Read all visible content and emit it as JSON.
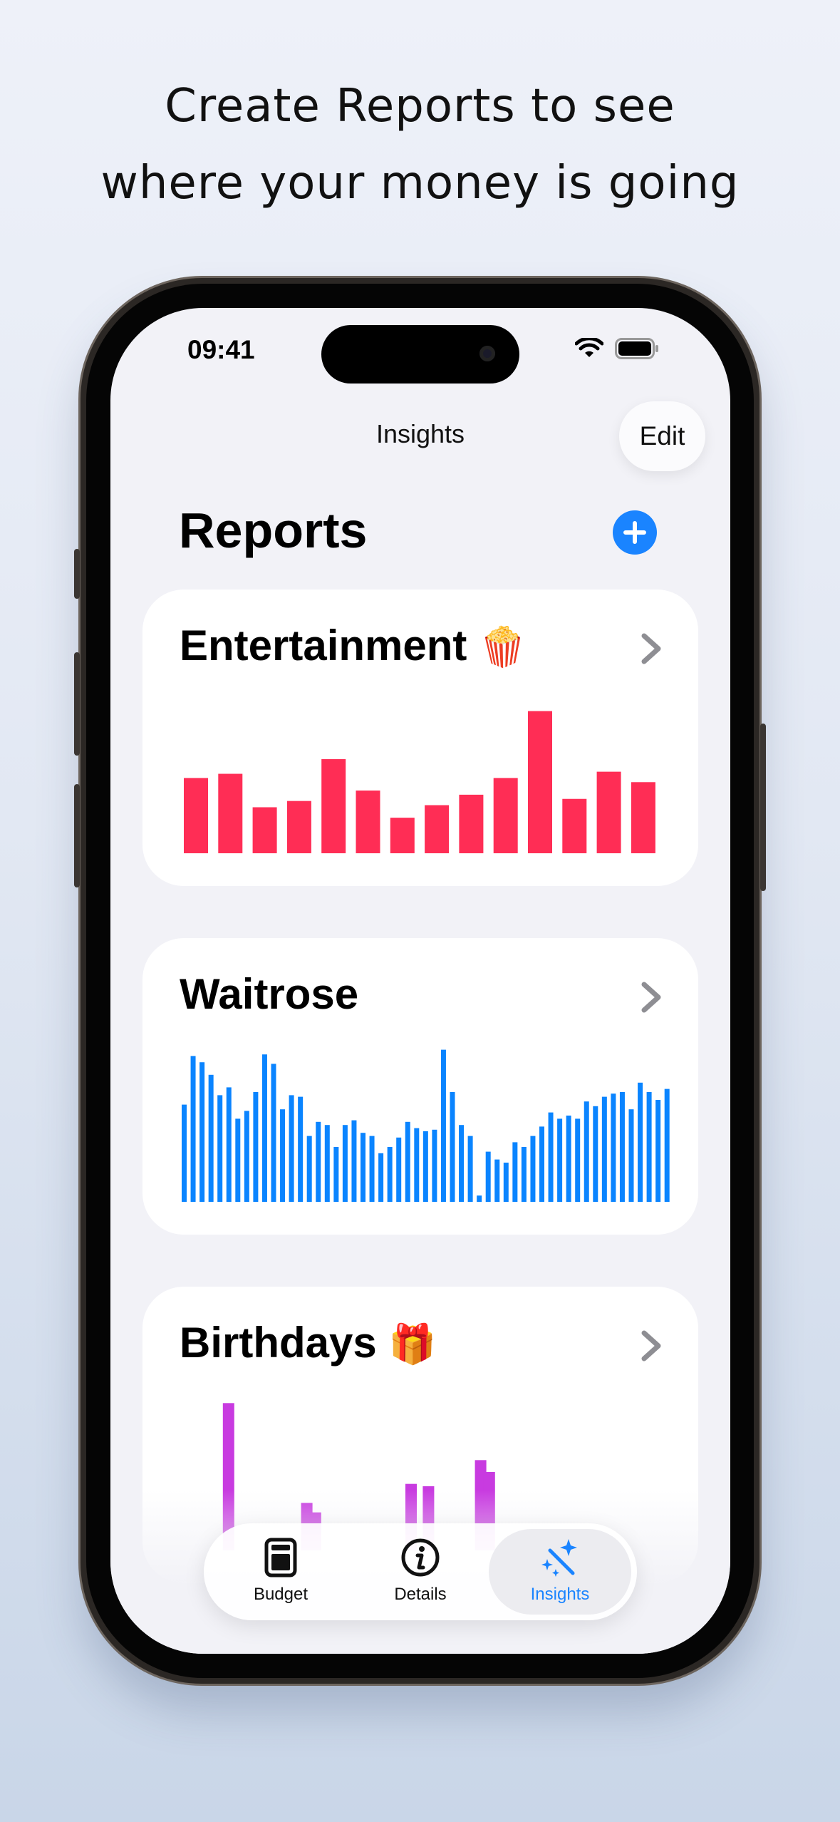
{
  "headline": {
    "line1": "Create Reports to see",
    "line2": "where your money is going"
  },
  "status": {
    "time": "09:41",
    "icons": [
      "wifi-icon",
      "battery-icon"
    ]
  },
  "nav": {
    "title": "Insights",
    "edit_label": "Edit"
  },
  "section": {
    "title": "Reports",
    "add_icon": "plus-icon"
  },
  "reports": [
    {
      "title": "Entertainment",
      "emoji": "🍿",
      "color": "#ff2d55",
      "values": [
        36,
        38,
        22,
        25,
        45,
        30,
        17,
        23,
        28,
        36,
        68,
        26,
        39,
        34
      ]
    },
    {
      "title": "Waitrose",
      "emoji": "",
      "color": "#0a84ff",
      "values": [
        62,
        93,
        89,
        81,
        68,
        73,
        53,
        58,
        70,
        94,
        88,
        59,
        68,
        67,
        42,
        51,
        49,
        35,
        49,
        52,
        44,
        42,
        31,
        35,
        41,
        51,
        47,
        45,
        46,
        97,
        70,
        49,
        42,
        4,
        32,
        27,
        25,
        38,
        35,
        42,
        48,
        57,
        53,
        55,
        53,
        64,
        61,
        67,
        69,
        70,
        59,
        76,
        70,
        65,
        72
      ]
    },
    {
      "title": "Birthdays",
      "emoji": "🎁",
      "color": "#c83be0",
      "values": [
        0,
        0,
        0,
        0,
        0,
        0,
        0,
        0,
        0,
        0,
        0,
        0,
        0,
        0,
        0,
        0,
        0,
        0,
        0,
        0,
        0,
        0,
        0,
        0,
        0,
        0,
        0,
        0,
        0,
        0
      ]
    }
  ],
  "birthdays_visible_values": {
    "positions": [
      4,
      13,
      14,
      25,
      27,
      33,
      34
    ],
    "values": [
      62,
      20,
      16,
      28,
      27,
      38,
      33
    ]
  },
  "tabs": [
    {
      "label": "Budget",
      "icon": "budget-icon",
      "active": false
    },
    {
      "label": "Details",
      "icon": "info-icon",
      "active": false
    },
    {
      "label": "Insights",
      "icon": "magic-wand-icon",
      "active": true
    }
  ],
  "colors": {
    "accent": "#1a84ff",
    "entertainment": "#ff2d55",
    "waitrose": "#0a84ff",
    "birthdays": "#c83be0"
  }
}
